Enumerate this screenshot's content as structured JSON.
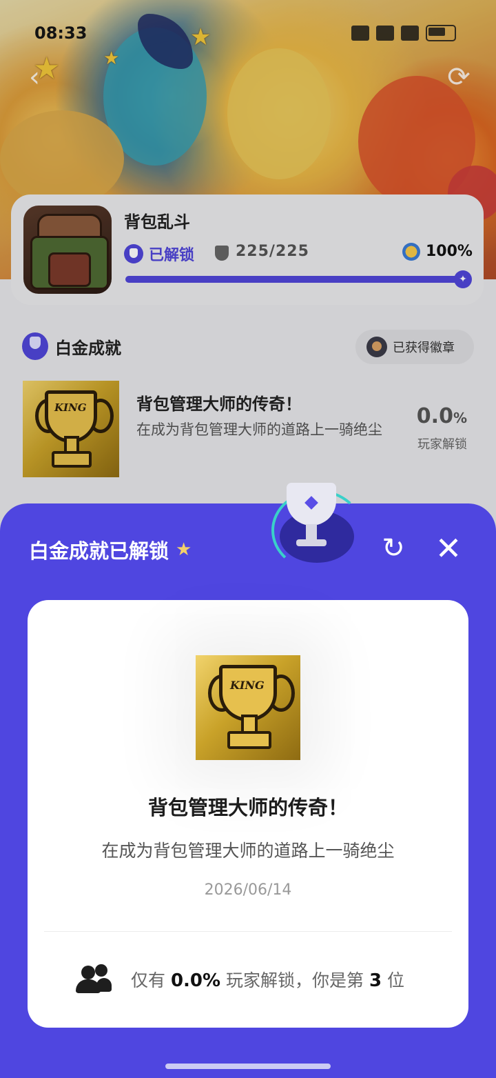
{
  "status_bar": {
    "time": "08:33"
  },
  "game": {
    "title": "背包乱斗",
    "unlocked_label": "已解锁",
    "trophy_count": "225/225",
    "completion": "100%",
    "progress_fraction": 1.0
  },
  "platinum": {
    "section_title": "白金成就",
    "earned_badges_label": "已获得徽章",
    "achievement": {
      "title": "背包管理大师的传奇！",
      "description": "在成为背包管理大师的道路上一骑绝尘",
      "rate_value": "0.0",
      "rate_unit": "%",
      "rate_label": "玩家解锁"
    }
  },
  "sheet": {
    "title": "白金成就已解锁",
    "card": {
      "art_text": "KING",
      "title": "背包管理大师的传奇！",
      "description": "在成为背包管理大师的道路上一骑绝尘",
      "date": "2026/06/14",
      "rank_prefix": "仅有",
      "rank_percent": "0.0%",
      "rank_middle": "玩家解锁，你是第",
      "rank_number": "3",
      "rank_suffix": "位"
    }
  },
  "icons": {
    "back": "back-arrow-icon",
    "share": "share-icon",
    "close": "close-icon",
    "users": "users-icon"
  },
  "colors": {
    "accent": "#4f46e0",
    "card_bg": "#ffffff",
    "page_bg": "#e6e6e9"
  }
}
